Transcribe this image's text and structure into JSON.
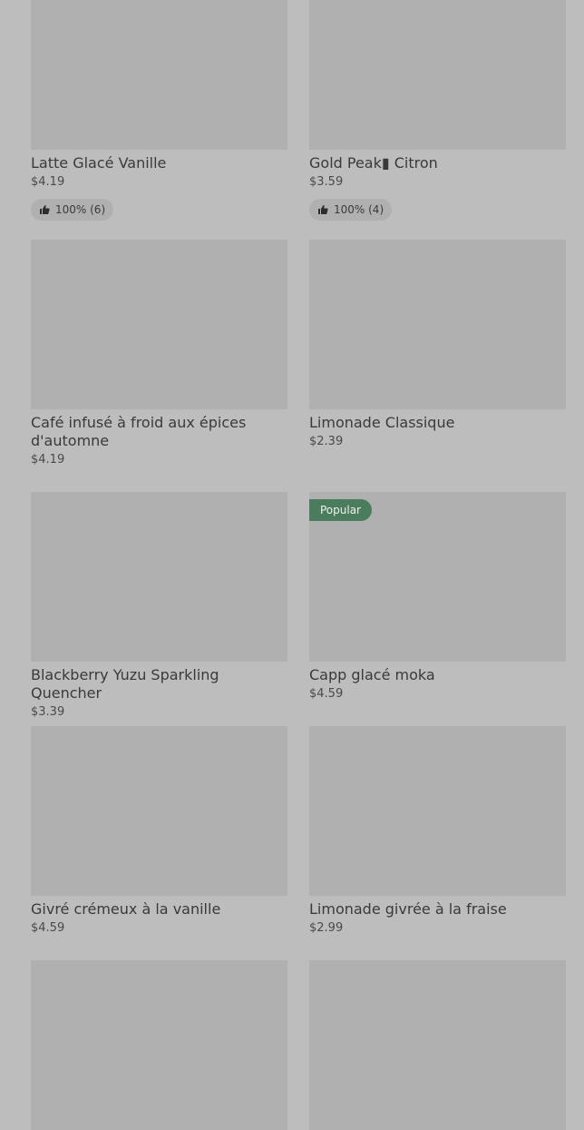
{
  "products": [
    {
      "title": "Latte Glacé Vanille",
      "price": "$4.19",
      "rating": "100% (6)"
    },
    {
      "title": "Gold Peak▮ Citron",
      "price": "$3.59",
      "rating": "100% (4)"
    },
    {
      "title": "Café infusé à froid aux épices d'automne",
      "price": "$4.19"
    },
    {
      "title": "Limonade Classique",
      "price": "$2.39"
    },
    {
      "title": "Blackberry Yuzu Sparkling Quencher",
      "price": "$3.39"
    },
    {
      "title": "Capp glacé moka",
      "price": "$4.59",
      "badge": "Popular"
    },
    {
      "title": "Givré crémeux à la vanille",
      "price": "$4.59"
    },
    {
      "title": "Limonade givrée à la fraise",
      "price": "$2.99"
    }
  ],
  "icons": {
    "rating": "thumbs-up-icon"
  },
  "colors": {
    "badge_bg": "#4a7d5c",
    "placeholder": "#b0b0b0",
    "background": "#bdbdbd"
  }
}
